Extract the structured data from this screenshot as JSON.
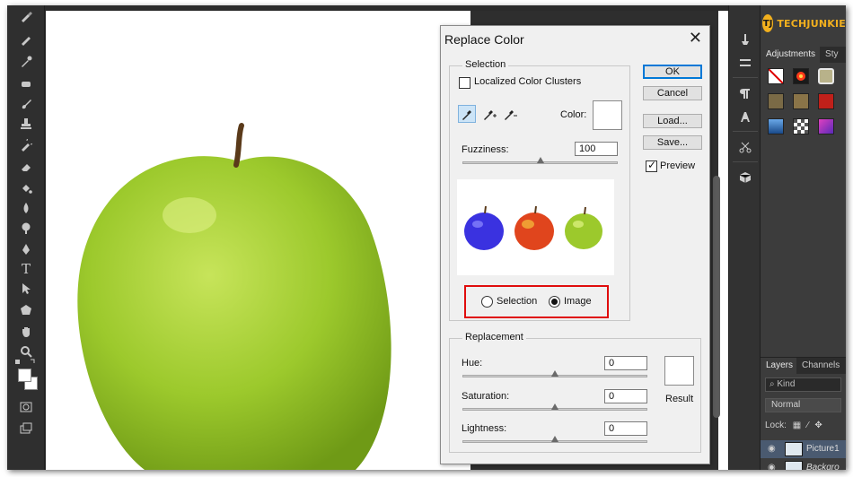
{
  "brand": {
    "logo_initials": "TJ",
    "logo_text": "TECHJUNKIE",
    "accent": "#f2b01e"
  },
  "panel_tabs": [
    "Adjustments",
    "Sty"
  ],
  "layers_panel": {
    "tabs": [
      "Layers",
      "Channels"
    ],
    "kind_label": "Kind",
    "blend_mode": "Normal",
    "lock_label": "Lock:",
    "layers": [
      {
        "name": "Picture1",
        "visible": true,
        "selected": true
      },
      {
        "name": "Backgro",
        "visible": true,
        "selected": false
      }
    ]
  },
  "dialog": {
    "title": "Replace Color",
    "close_glyph": "✕",
    "selection_group": {
      "legend": "Selection",
      "localized_clusters_label": "Localized Color Clusters",
      "localized_clusters_checked": false,
      "color_label": "Color:",
      "color_value": "#ffffff",
      "fuzziness_label": "Fuzziness:",
      "fuzziness_value": "100",
      "fuzziness_fraction": 0.5,
      "view_options": [
        {
          "label": "Selection",
          "checked": false
        },
        {
          "label": "Image",
          "checked": true
        }
      ]
    },
    "buttons": {
      "ok": "OK",
      "cancel": "Cancel",
      "load": "Load...",
      "save": "Save..."
    },
    "preview": {
      "label": "Preview",
      "checked": true
    },
    "replacement_group": {
      "legend": "Replacement",
      "hue_label": "Hue:",
      "hue_value": "0",
      "hue_fraction": 0.5,
      "saturation_label": "Saturation:",
      "saturation_value": "0",
      "saturation_fraction": 0.5,
      "lightness_label": "Lightness:",
      "lightness_value": "0",
      "lightness_fraction": 0.5,
      "result_label": "Result",
      "result_color": "#ffffff"
    }
  },
  "colors": {
    "apple_green": "#9cc92c",
    "apple_blue": "#3a32e0",
    "apple_red": "#e0451d",
    "highlight_red": "#e00d0d"
  }
}
